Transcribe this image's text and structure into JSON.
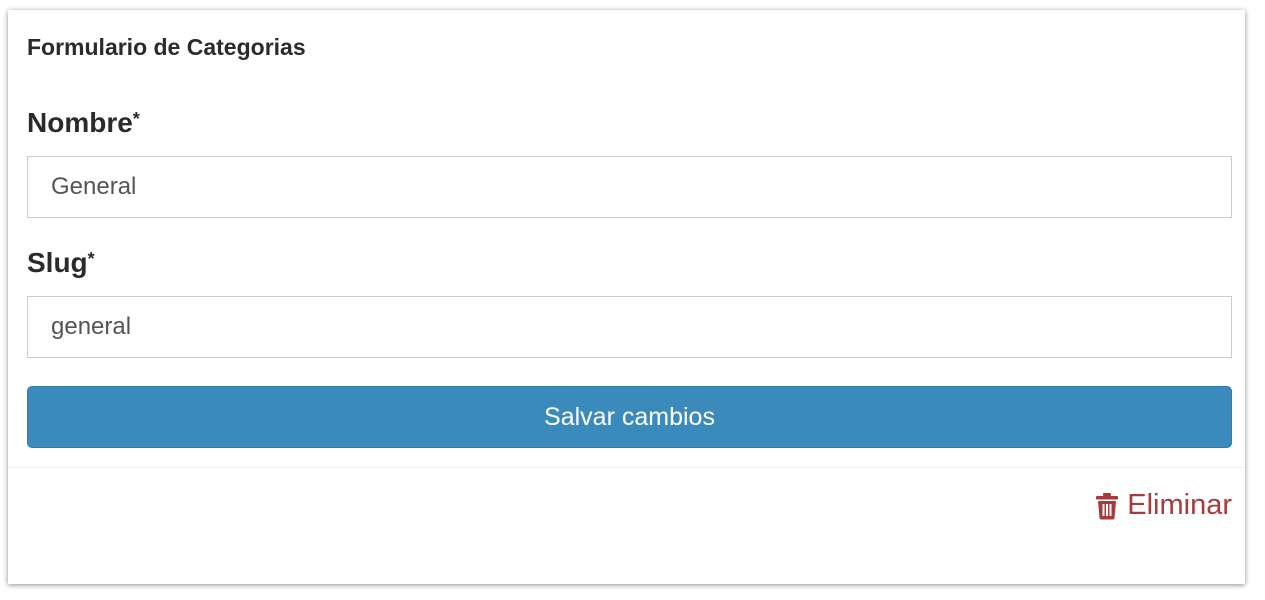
{
  "form": {
    "title": "Formulario de Categorias",
    "fields": [
      {
        "label": "Nombre",
        "required_mark": "*",
        "value": "General"
      },
      {
        "label": "Slug",
        "required_mark": "*",
        "value": "general"
      }
    ],
    "save_label": "Salvar cambios",
    "delete_label": "Eliminar",
    "delete_icon": "trash-icon"
  },
  "colors": {
    "primary": "#3a8bbb",
    "danger": "#a73a3a"
  }
}
